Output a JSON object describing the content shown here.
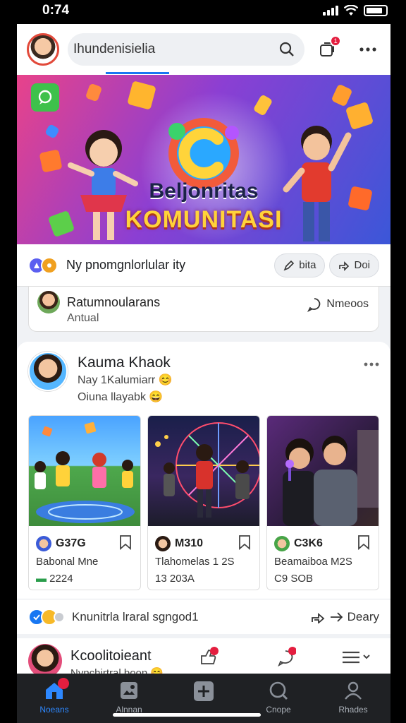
{
  "status_bar": {
    "time": "0:74"
  },
  "header": {
    "search_text": "Ihundenisielia",
    "notification_count": "1"
  },
  "banner": {
    "title_line1": "Beljonritas",
    "title_line2": "KOMUNITASI"
  },
  "action_bar": {
    "text": "Ny pnomgnlorlular ity",
    "btn_edit": "bita",
    "btn_share": "Doi"
  },
  "comment": {
    "name": "Ratumnoularans",
    "sub": "Antual",
    "reply": "Nmeoos"
  },
  "post": {
    "author": "Kauma Khaok",
    "line1": "Nay 1Kalumiarr 😊",
    "line2": "Oiuna llayabk 😄",
    "tiles": [
      {
        "stat": "G37G",
        "title": "Babonal Mne",
        "sub": "2224"
      },
      {
        "stat": "M310",
        "title": "Tlahomelas 1 2S",
        "sub": "13 203A"
      },
      {
        "stat": "C3K6",
        "title": "Beamaiboa M2S",
        "sub": "C9 SOB"
      }
    ]
  },
  "reaction_bar": {
    "text": "Knunitrla lraral sgngod1",
    "action": "Deary"
  },
  "next_post": {
    "author": "Kcoolitoieant",
    "sub": "Nynchirtral boon 😊"
  },
  "bottom_nav": [
    {
      "label": "Noeans",
      "icon": "home-icon",
      "active": true
    },
    {
      "label": "Alnnan",
      "icon": "media-icon",
      "active": false
    },
    {
      "label": "",
      "icon": "plus-icon",
      "active": false
    },
    {
      "label": "Cnope",
      "icon": "search-icon",
      "active": false
    },
    {
      "label": "Rhades",
      "icon": "profile-icon",
      "active": false
    }
  ],
  "colors": {
    "accent": "#1877f2",
    "badge": "#e41e3f",
    "nav_bg": "#1f2124"
  }
}
